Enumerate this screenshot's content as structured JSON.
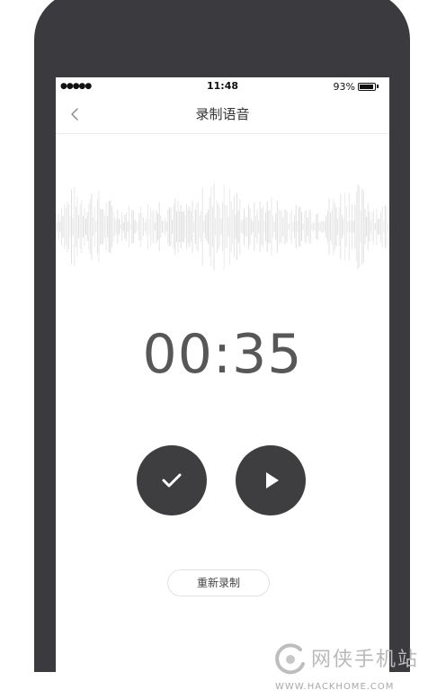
{
  "status_bar": {
    "signal": "●●●●●",
    "time": "11:48",
    "battery_percent": "93%",
    "battery_level": 0.93
  },
  "nav": {
    "back_icon": "chevron-left-icon",
    "title": "录制语音"
  },
  "recorder": {
    "waveform_icon": "waveform",
    "elapsed": "00:35",
    "confirm_icon": "checkmark-icon",
    "play_icon": "play-icon",
    "rerecord_label": "重新录制"
  },
  "watermark": {
    "cn_text": "网侠手机站",
    "en_text": "WWW.HACKHOME.COM"
  },
  "colors": {
    "phone_frame": "#3b3a3f",
    "button_fill": "#3e3e40",
    "timer_text": "#575757",
    "waveform": "#dcdcdc"
  }
}
